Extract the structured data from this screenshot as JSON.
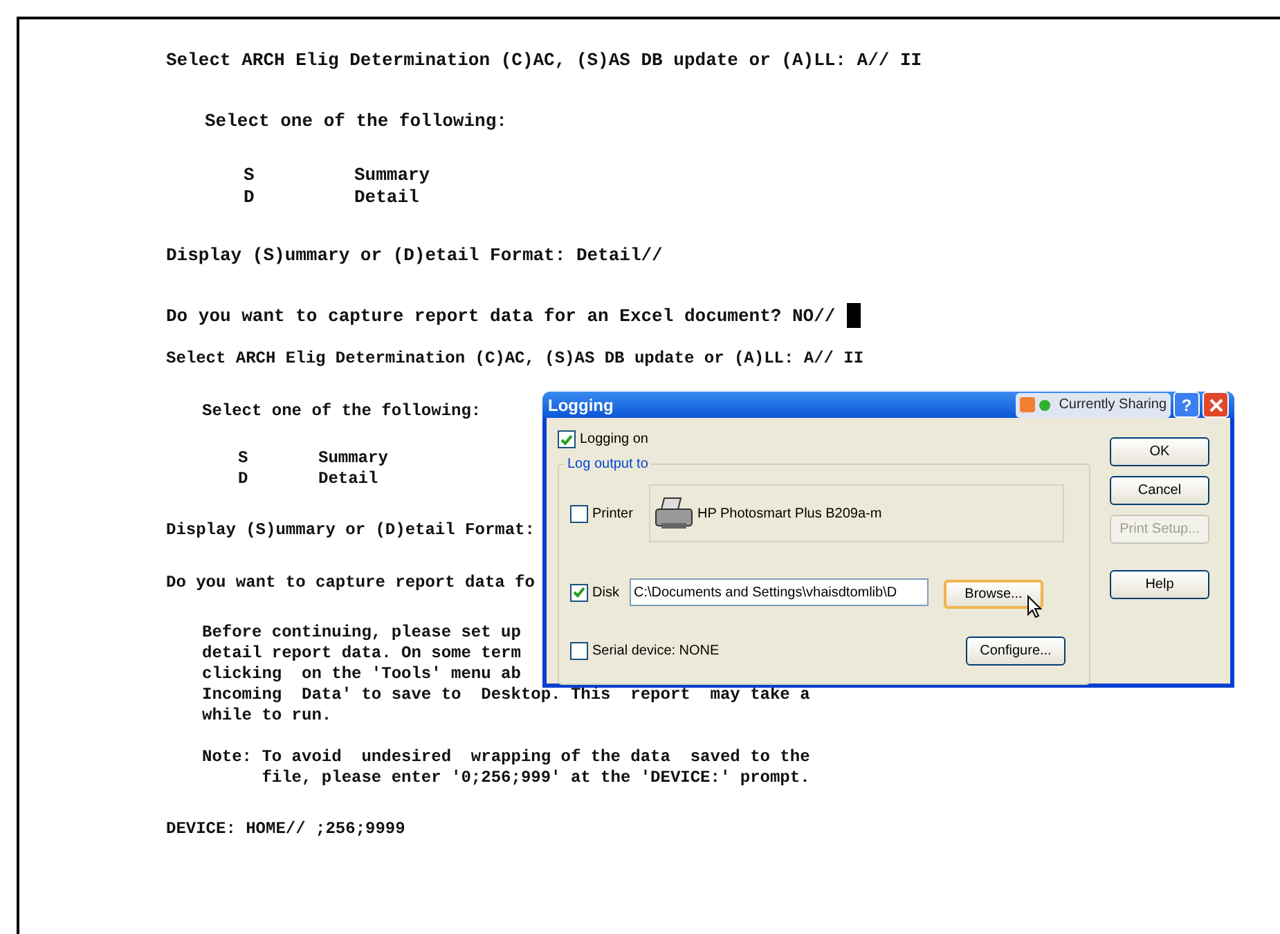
{
  "screen_1": {
    "prompt": "Select ARCH Elig Determination (C)AC, (S)AS DB update or (A)LL: A// II",
    "heading": "Select one of the following:",
    "options": [
      {
        "key": "S",
        "label": "Summary"
      },
      {
        "key": "D",
        "label": "Detail"
      }
    ],
    "format_prompt": "Display (S)ummary or (D)etail Format: Detail//",
    "excel_prompt": "Do you want to capture report data for an Excel document? NO//",
    "cursor": true
  },
  "screen_2": {
    "prompt": "Select ARCH Elig Determination (C)AC, (S)AS DB update or (A)LL: A// II",
    "heading": "Select one of the following:",
    "options": [
      {
        "key": "S",
        "label": "Summary"
      },
      {
        "key": "D",
        "label": "Detail"
      }
    ],
    "format_prompt": "Display (S)ummary or (D)etail Format:",
    "excel_prompt": "Do you want to capture report data fo",
    "instructions": [
      "Before continuing, please set up",
      "detail report data. On some term",
      "clicking  on the 'Tools' menu ab",
      "Incoming  Data' to save to  Desktop. This  report  may take a",
      "while to run."
    ],
    "note": [
      "Note: To avoid  undesired  wrapping of the data  saved to the",
      "      file, please enter '0;256;999' at the 'DEVICE:' prompt."
    ],
    "device_prompt": "DEVICE: HOME// ;256;9999"
  },
  "dialog": {
    "title": "Logging",
    "sharing_label": "Currently Sharing",
    "help_glyph": "?",
    "logging_on": {
      "label": "Logging on",
      "checked": true
    },
    "group_label": "Log output to",
    "printer": {
      "label": "Printer",
      "checked": false,
      "name": "HP Photosmart Plus B209a-m"
    },
    "disk": {
      "label": "Disk",
      "checked": true,
      "path": "C:\\Documents and Settings\\vhaisdtomlib\\D",
      "button": {
        "label": "Browse...",
        "hovered": true
      }
    },
    "serial": {
      "label": "Serial device:  NONE",
      "checked": false,
      "button": {
        "label": "Configure...",
        "hovered": false
      }
    },
    "side_buttons": [
      {
        "label": "OK",
        "disabled": false
      },
      {
        "label": "Cancel",
        "disabled": false
      },
      {
        "label": "Print Setup...",
        "disabled": true
      },
      {
        "label": "Help",
        "disabled": false
      }
    ]
  }
}
